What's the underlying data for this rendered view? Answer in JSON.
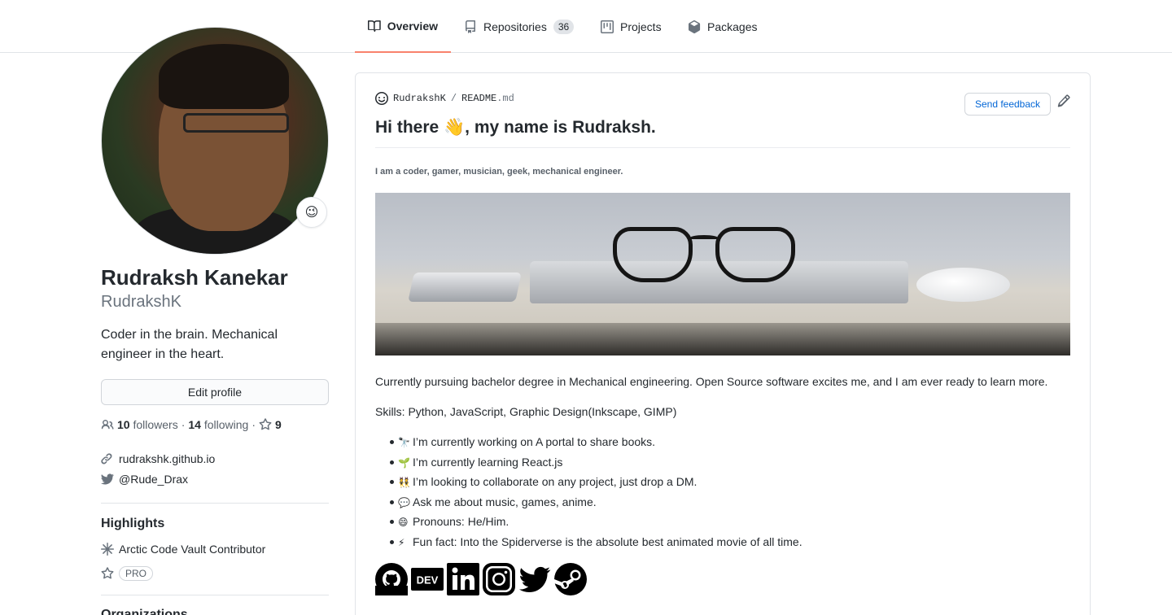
{
  "tabs": [
    {
      "label": "Overview",
      "icon": "book-icon",
      "active": true
    },
    {
      "label": "Repositories",
      "icon": "repo-icon",
      "count": "36"
    },
    {
      "label": "Projects",
      "icon": "project-icon"
    },
    {
      "label": "Packages",
      "icon": "package-icon"
    }
  ],
  "profile": {
    "status_emoji": "😉",
    "fullname": "Rudraksh Kanekar",
    "username": "RudrakshK",
    "bio": "Coder in the brain. Mechanical engineer in the heart.",
    "edit_label": "Edit profile",
    "followers_count": "10",
    "followers_label": "followers",
    "following_count": "14",
    "following_label": "following",
    "stars_count": "9",
    "website": "rudrakshk.github.io",
    "twitter": "@Rude_Drax"
  },
  "highlights": {
    "title": "Highlights",
    "items": [
      {
        "label": "Arctic Code Vault Contributor",
        "icon": "snowflake-icon"
      },
      {
        "label": "PRO",
        "icon": "star-icon"
      }
    ]
  },
  "organizations": {
    "title": "Organizations"
  },
  "readme": {
    "owner": "RudrakshK",
    "sep": "/",
    "file": "README",
    "ext": ".md",
    "feedback_label": "Send feedback",
    "heading": "Hi there 👋, my name is Rudraksh.",
    "tagline": "I am a coder, gamer, musician, geek, mechanical engineer.",
    "para1": "Currently pursuing bachelor degree in Mechanical engineering. Open Source software excites me, and I am ever ready to learn more.",
    "skills": "Skills: Python, JavaScript, Graphic Design(Inkscape, GIMP)",
    "bullets": [
      {
        "emoji": "🔭",
        "text": "I’m currently working on A portal to share books."
      },
      {
        "emoji": "🌱",
        "text": "I’m currently learning React.js"
      },
      {
        "emoji": "👯",
        "text": "I’m looking to collaborate on any project, just drop a DM."
      },
      {
        "emoji": "💬",
        "text": "Ask me about music, games, anime."
      },
      {
        "emoji": "😄",
        "text": "Pronouns: He/Him."
      },
      {
        "emoji": "⚡",
        "text": "Fun fact: Into the Spiderverse is the absolute best animated movie of all time."
      }
    ],
    "social_icons": [
      "github-icon",
      "dev-icon",
      "linkedin-icon",
      "instagram-icon",
      "twitter-icon",
      "steam-icon"
    ],
    "dev_text": "DEV"
  },
  "colors": {
    "accent": "#f9826c",
    "link": "#0366d6",
    "text": "#24292e",
    "muted": "#6a737d"
  }
}
